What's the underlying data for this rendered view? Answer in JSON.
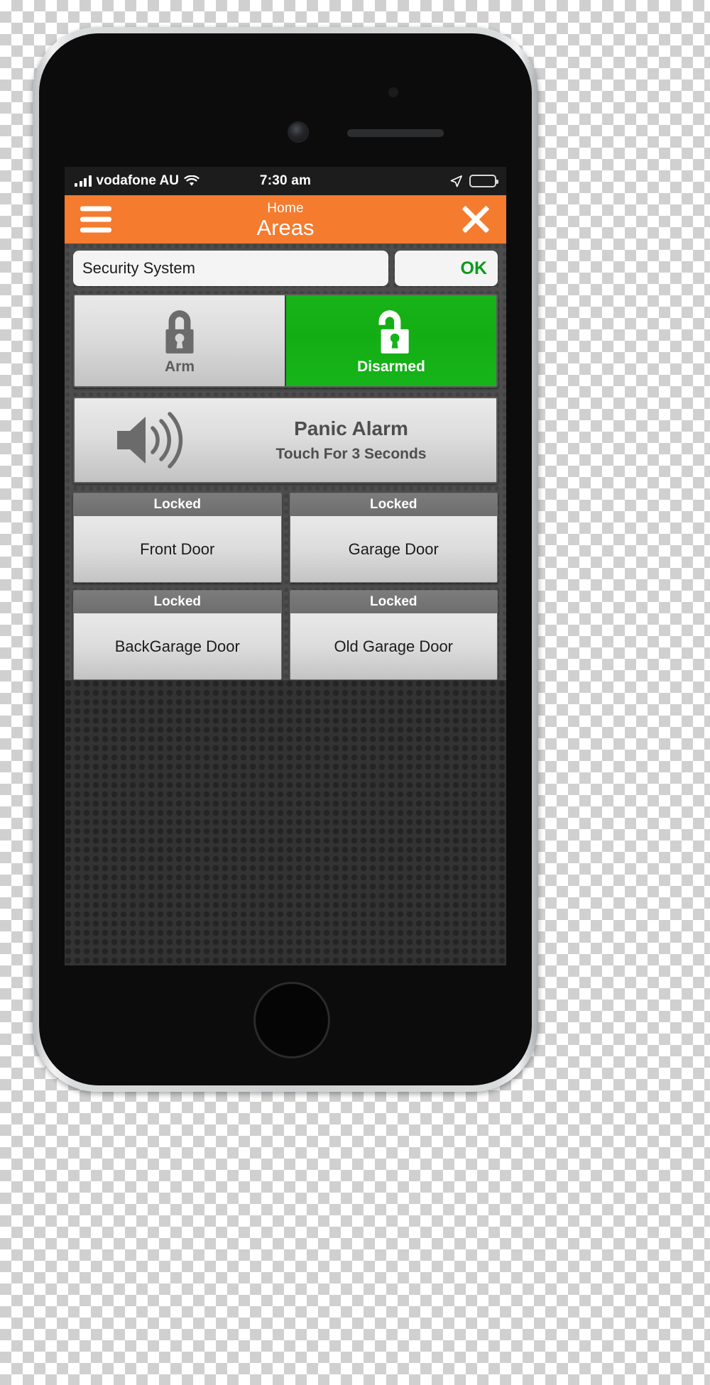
{
  "status_bar": {
    "carrier": "vodafone AU",
    "time": "7:30 am",
    "signal_icon": "signal-bars-icon",
    "wifi_icon": "wifi-icon",
    "location_icon": "location-arrow-icon",
    "battery_icon": "battery-icon"
  },
  "header": {
    "menu_icon": "hamburger-menu-icon",
    "subtitle": "Home",
    "title": "Areas",
    "close_icon": "close-x-icon",
    "background_color": "#f57b2e"
  },
  "system": {
    "name": "Security System",
    "status": "OK",
    "status_color": "#0a9a1b"
  },
  "arm_controls": [
    {
      "label": "Arm",
      "icon": "padlock-closed-icon",
      "state": "inactive"
    },
    {
      "label": "Disarmed",
      "icon": "padlock-open-icon",
      "state": "active",
      "color": "#16b41a"
    }
  ],
  "panic": {
    "icon": "speaker-volume-icon",
    "title": "Panic Alarm",
    "subtitle": "Touch For 3 Seconds"
  },
  "doors": [
    {
      "status": "Locked",
      "name": "Front Door"
    },
    {
      "status": "Locked",
      "name": "Garage Door"
    },
    {
      "status": "Locked",
      "name": "BackGarage Door"
    },
    {
      "status": "Locked",
      "name": "Old Garage Door"
    }
  ]
}
